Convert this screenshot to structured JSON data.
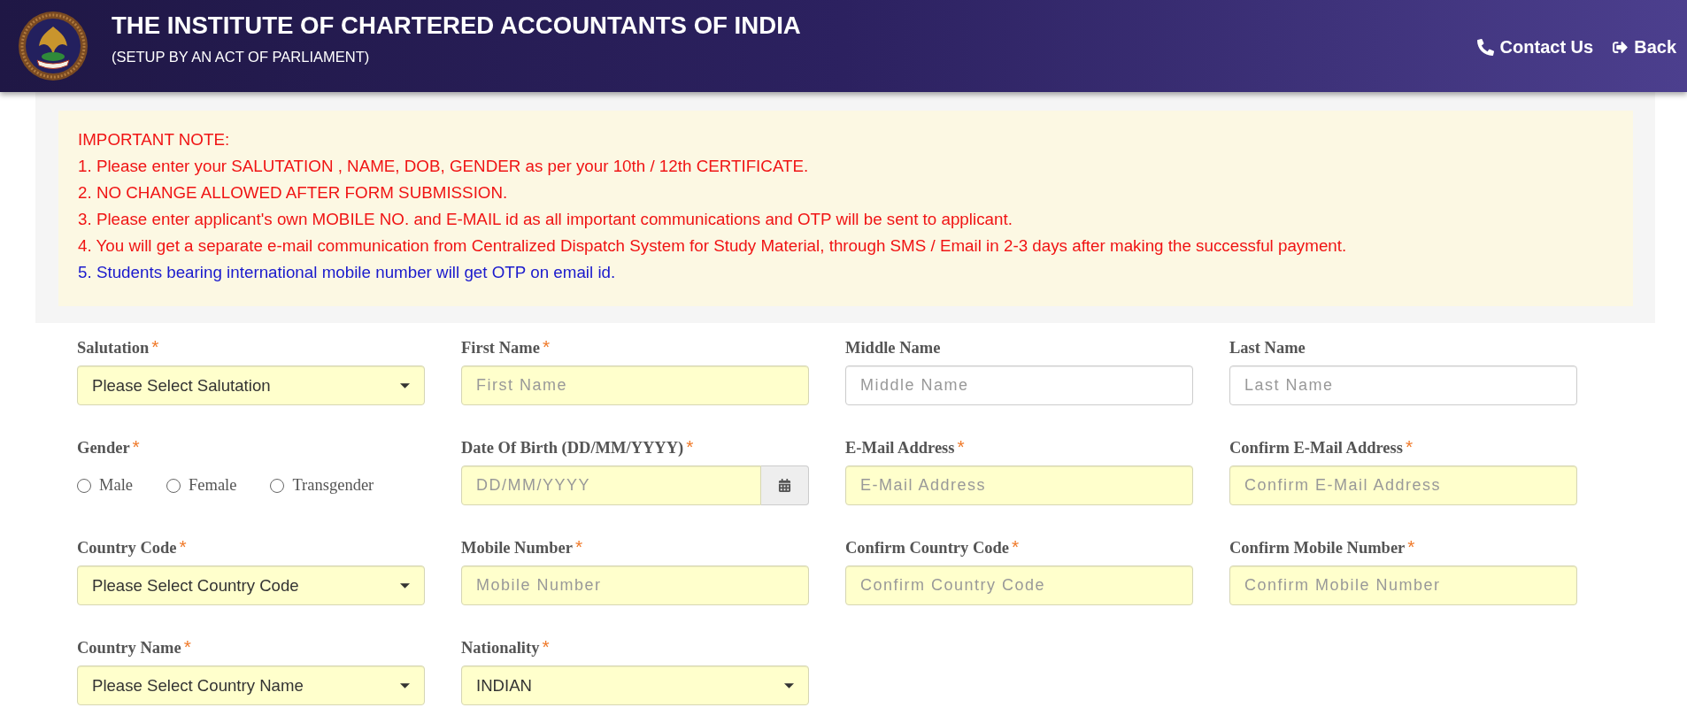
{
  "header": {
    "title": "THE INSTITUTE OF CHARTERED ACCOUNTANTS OF INDIA",
    "subtitle": "(SETUP BY AN ACT OF PARLIAMENT)",
    "contact_link": "Contact Us",
    "back_link": "Back"
  },
  "notice": {
    "heading": "IMPORTANT NOTE:",
    "items": [
      {
        "text": "1. Please enter your SALUTATION , NAME, DOB, GENDER as per your 10th / 12th CERTIFICATE.",
        "color": "#f01414"
      },
      {
        "text": "2. NO CHANGE ALLOWED AFTER FORM SUBMISSION.",
        "color": "#f01414"
      },
      {
        "text": "3. Please enter applicant's own MOBILE NO. and E-MAIL id as all important communications and OTP will be sent to applicant.",
        "color": "#f01414"
      },
      {
        "text": "4. You will get a separate e-mail communication from Centralized Dispatch System for Study Material, through SMS / Email in 2-3 days after making the successful payment.",
        "color": "#f01414"
      },
      {
        "text": "5. Students bearing international mobile number will get OTP on email id.",
        "color": "#1a1acd"
      }
    ]
  },
  "form": {
    "fields": [
      {
        "kind": "select",
        "label": "Salutation",
        "required": true,
        "mark": "*",
        "value": "Please Select Salutation"
      },
      {
        "kind": "text",
        "label": "First Name",
        "required": true,
        "mark": "*",
        "placeholder": "First Name"
      },
      {
        "kind": "text",
        "label": "Middle Name",
        "required": false,
        "placeholder": "Middle Name"
      },
      {
        "kind": "text",
        "label": "Last Name",
        "required": false,
        "placeholder": "Last Name"
      },
      {
        "kind": "radio",
        "label": "Gender",
        "required": true,
        "mark": "*",
        "options": [
          {
            "label": "Male",
            "selected": false
          },
          {
            "label": "Female",
            "selected": false
          },
          {
            "label": "Transgender",
            "selected": false
          }
        ]
      },
      {
        "kind": "date",
        "label": "Date Of Birth (DD/MM/YYYY)",
        "required": true,
        "mark": "*",
        "placeholder": "DD/MM/YYYY"
      },
      {
        "kind": "text",
        "label": "E-Mail Address",
        "required": true,
        "mark": "*",
        "placeholder": "E-Mail Address"
      },
      {
        "kind": "text",
        "label": "Confirm E-Mail Address",
        "required": true,
        "mark": "*",
        "placeholder": "Confirm E-Mail Address"
      },
      {
        "kind": "select",
        "label": "Country Code",
        "required": true,
        "mark": "*",
        "value": "Please Select Country Code"
      },
      {
        "kind": "text",
        "label": "Mobile Number",
        "required": true,
        "mark": "*",
        "placeholder": "Mobile Number"
      },
      {
        "kind": "text",
        "label": "Confirm Country Code",
        "required": true,
        "mark": "*",
        "placeholder": "Confirm Country Code"
      },
      {
        "kind": "text",
        "label": "Confirm Mobile Number",
        "required": true,
        "mark": "*",
        "placeholder": "Confirm Mobile Number"
      },
      {
        "kind": "select",
        "label": "Country Name",
        "required": true,
        "mark": "*",
        "value": "Please Select Country Name"
      },
      {
        "kind": "select",
        "label": "Nationality",
        "required": true,
        "mark": "*",
        "value": "INDIAN"
      }
    ]
  }
}
